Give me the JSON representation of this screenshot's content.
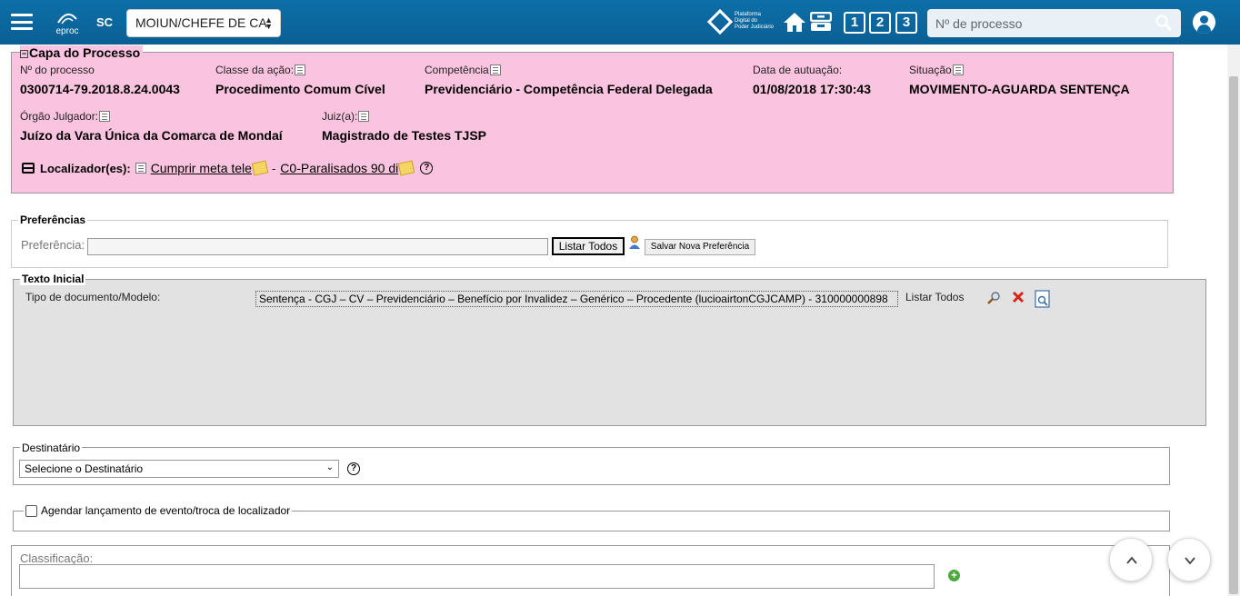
{
  "header": {
    "logo_text": "eproc",
    "state": "SC",
    "unit_selected": "MOIUN/CHEFE DE CA",
    "pdpj_text": [
      "Plataforma",
      "Digital do",
      "Poder Judiciário"
    ],
    "shortcuts": [
      "1",
      "2",
      "3"
    ],
    "search_placeholder": "Nº de processo"
  },
  "capa": {
    "title": "Capa do Processo",
    "numero_label": "Nº do processo",
    "numero_value": "0300714-79.2018.8.24.0043",
    "classe_label": "Classe da ação:",
    "classe_value": "Procedimento Comum Cível",
    "competencia_label": "Competência",
    "competencia_value": "Previdenciário - Competência Federal Delegada",
    "data_label": "Data de autuação:",
    "data_value": "01/08/2018 17:30:43",
    "situacao_label": "Situação",
    "situacao_value": "MOVIMENTO-AGUARDA SENTENÇA",
    "orgao_label": "Órgão Julgador:",
    "orgao_value": "Juízo da Vara Única da Comarca de Mondaí",
    "juiz_label": "Juiz(a):",
    "juiz_value": "Magistrado de Testes TJSP",
    "localizador_label": "Localizador(es):",
    "localizador_1": "Cumprir meta tele",
    "localizador_sep": "-",
    "localizador_2": "C0-Paralisados 90 di"
  },
  "preferencias": {
    "legend": "Preferências",
    "label": "Preferência:",
    "value": "",
    "listar_todos": "Listar Todos",
    "salvar": "Salvar Nova Preferência"
  },
  "texto_inicial": {
    "legend": "Texto Inicial",
    "tipo_label": "Tipo de documento/Modelo:",
    "modelo_value": "Sentença - CGJ – CV – Previdenciário – Benefício por Invalidez – Genérico – Procedente (lucioairtonCGJCAMP) - 310000000898",
    "listar_todos": "Listar Todos"
  },
  "destinatario": {
    "legend": "Destinatário",
    "selected": "Selecione o Destinatário"
  },
  "agendar": {
    "label": "Agendar lançamento de evento/troca de localizador",
    "checked": false
  },
  "classificacao": {
    "label": "Classificação:",
    "value": ""
  },
  "colors": {
    "topbar": "#0b6aa3",
    "capa_bg": "#fac3df",
    "texto_bg": "#e2e2e2",
    "delete_red": "#d9261c",
    "add_green": "#4caa3c"
  }
}
